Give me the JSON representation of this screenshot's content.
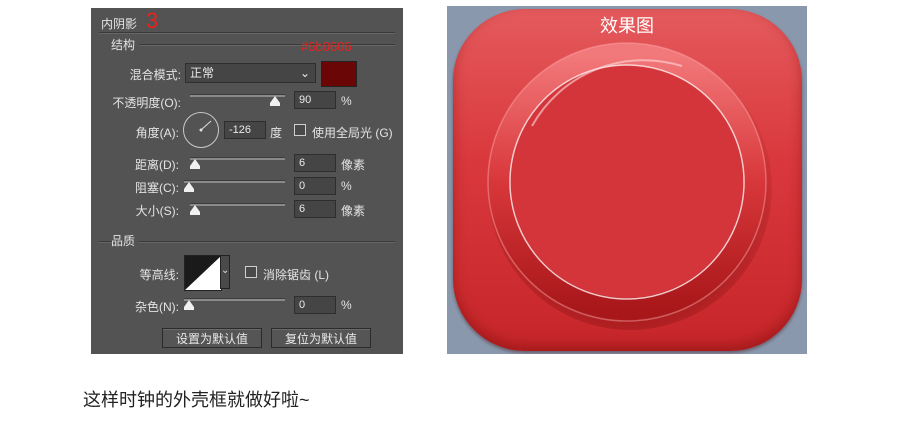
{
  "panel": {
    "title": "内阴影",
    "step_number": "3",
    "structure_heading": "结构",
    "hex_annotation": "#6b0606",
    "blend_mode": {
      "label": "混合模式:",
      "value": "正常",
      "swatch_color": "#6b0606"
    },
    "opacity": {
      "label": "不透明度(O):",
      "value": "90",
      "unit": "%",
      "level_percent": 90
    },
    "angle": {
      "label": "角度(A):",
      "value": "-126",
      "unit": "度",
      "global_light_label": "使用全局光 (G)"
    },
    "distance": {
      "label": "距离(D):",
      "value": "6",
      "unit": "像素"
    },
    "choke": {
      "label": "阻塞(C):",
      "value": "0",
      "unit": "%"
    },
    "size": {
      "label": "大小(S):",
      "value": "6",
      "unit": "像素"
    },
    "quality_heading": "品质",
    "contour": {
      "label": "等高线:",
      "anti_alias_label": "消除锯齿 (L)"
    },
    "noise": {
      "label": "杂色(N):",
      "value": "0",
      "unit": "%"
    },
    "set_default_button": "设置为默认值",
    "reset_default_button": "复位为默认值"
  },
  "preview": {
    "title": "效果图",
    "background_color": "#8a98ad",
    "icon_color": "#d9383c"
  },
  "caption": "这样时钟的外壳框就做好啦~"
}
